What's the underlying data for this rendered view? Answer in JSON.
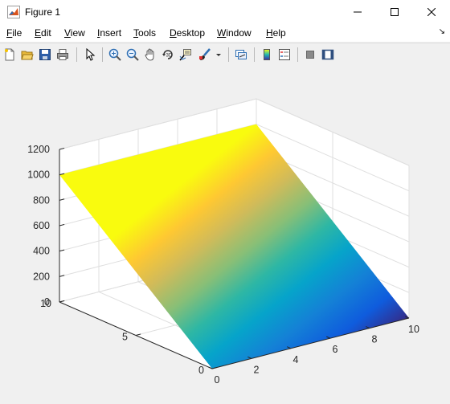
{
  "window": {
    "title": "Figure 1",
    "controls": [
      "minimize",
      "maximize",
      "close"
    ]
  },
  "menu": [
    {
      "label": "File",
      "mnemonic": "F",
      "rest": "ile"
    },
    {
      "label": "Edit",
      "mnemonic": "E",
      "rest": "dit"
    },
    {
      "label": "View",
      "mnemonic": "V",
      "rest": "iew"
    },
    {
      "label": "Insert",
      "mnemonic": "I",
      "rest": "nsert"
    },
    {
      "label": "Tools",
      "mnemonic": "T",
      "rest": "ools"
    },
    {
      "label": "Desktop",
      "mnemonic": "D",
      "rest": "esktop"
    },
    {
      "label": "Window",
      "mnemonic": "W",
      "rest": "indow"
    },
    {
      "label": "Help",
      "mnemonic": "H",
      "rest": "elp"
    }
  ],
  "dock_arrow": "↘",
  "toolbar": {
    "buttons": [
      "new-figure-icon",
      "open-file-icon",
      "save-icon",
      "print-icon",
      "edit-plot-icon",
      "zoom-in-icon",
      "zoom-out-icon",
      "pan-icon",
      "rotate-3d-icon",
      "data-cursor-icon",
      "brush-icon",
      "brush-dropdown-icon",
      "link-plot-icon",
      "insert-colorbar-icon",
      "insert-legend-icon",
      "hide-plot-tools-icon",
      "show-plot-tools-icon"
    ]
  },
  "chart_data": {
    "type": "surface",
    "title": "",
    "view": "3d",
    "colormap": "parula",
    "x": {
      "range": [
        0,
        10
      ],
      "ticks": [
        0,
        2,
        4,
        6,
        8,
        10
      ],
      "tick_labels": [
        "0",
        "2",
        "4",
        "6",
        "8",
        "10"
      ]
    },
    "y": {
      "range": [
        0,
        10
      ],
      "ticks": [
        0,
        5,
        10
      ],
      "tick_labels": [
        "0",
        "5",
        "10"
      ]
    },
    "z": {
      "range": [
        0,
        1200
      ],
      "ticks": [
        0,
        200,
        400,
        600,
        800,
        1000,
        1200
      ],
      "tick_labels": [
        "0",
        "200",
        "400",
        "600",
        "800",
        "1000",
        "1200"
      ]
    },
    "surface_corners": [
      {
        "x": 0,
        "y": 0,
        "z": 0
      },
      {
        "x": 10,
        "y": 0,
        "z": 0
      },
      {
        "x": 10,
        "y": 10,
        "z": 1000
      },
      {
        "x": 0,
        "y": 10,
        "z": 1000
      }
    ],
    "grid": true,
    "box": true,
    "colors": {
      "axes_bg": "#ffffff",
      "grid": "#dfdfdf",
      "axis_line": "#262626"
    }
  }
}
